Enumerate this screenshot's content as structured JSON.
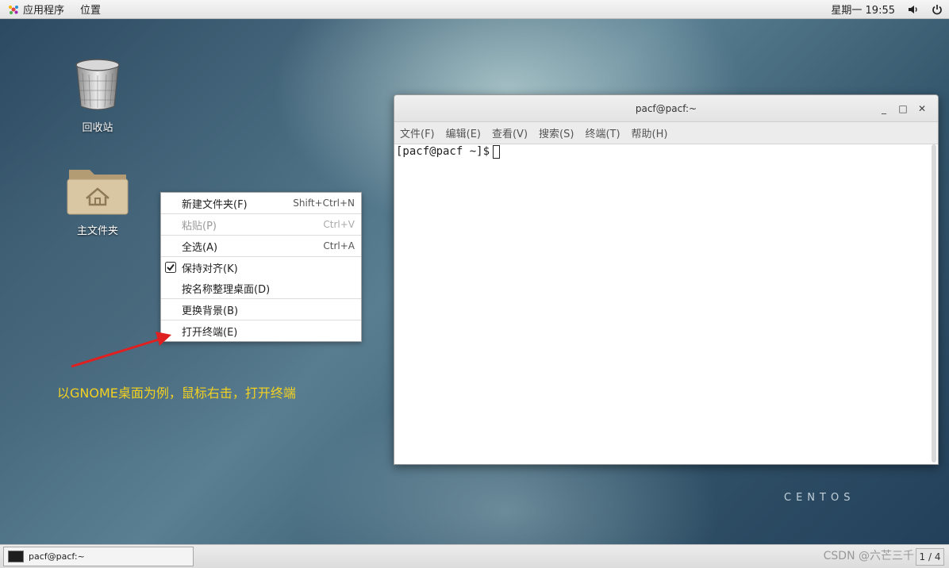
{
  "topbar": {
    "apps_label": "应用程序",
    "places_label": "位置",
    "clock": "星期一 19:55"
  },
  "desktop": {
    "icons": [
      {
        "label": "回收站",
        "icon": "trash-icon"
      },
      {
        "label": "主文件夹",
        "icon": "home-folder-icon"
      }
    ]
  },
  "context_menu": {
    "items": [
      {
        "label": "新建文件夹(F)",
        "accel": "Shift+Ctrl+N",
        "disabled": false
      },
      {
        "label": "粘贴(P)",
        "accel": "Ctrl+V",
        "disabled": true
      },
      {
        "label": "全选(A)",
        "accel": "Ctrl+A",
        "disabled": false
      },
      {
        "label": "保持对齐(K)",
        "accel": "",
        "checked": true
      },
      {
        "label": "按名称整理桌面(D)",
        "accel": ""
      },
      {
        "label": "更换背景(B)",
        "accel": ""
      },
      {
        "label": "打开终端(E)",
        "accel": ""
      }
    ]
  },
  "annotation": {
    "text": "以GNOME桌面为例，鼠标右击，打开终端",
    "color": "#f4d21f",
    "arrow_color": "#e02020"
  },
  "terminal": {
    "title": "pacf@pacf:~",
    "menu": [
      "文件(F)",
      "编辑(E)",
      "查看(V)",
      "搜索(S)",
      "终端(T)",
      "帮助(H)"
    ],
    "prompt": "[pacf@pacf ~]$"
  },
  "branding": {
    "centos": "CENTOS"
  },
  "taskbar": {
    "task_label": "pacf@pacf:~",
    "watermark": "CSDN @六芒三千",
    "workspace": "1 / 4"
  }
}
